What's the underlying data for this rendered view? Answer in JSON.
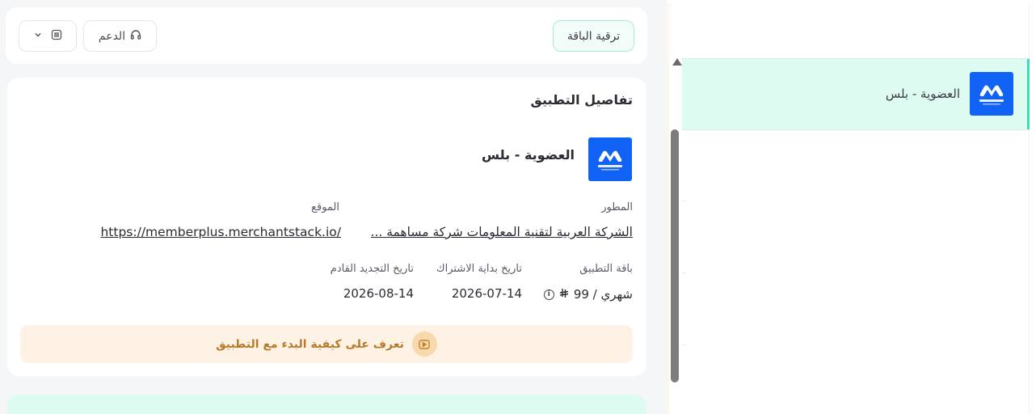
{
  "header": {
    "upgrade_label": "ترقية الباقة",
    "support_label": "الدعم"
  },
  "sidebar": {
    "items": [
      {
        "label": "العضوية - بلس",
        "active": true
      }
    ],
    "logo_text": "Member Plus"
  },
  "details": {
    "title": "تفاصيل التطبيق",
    "app_name": "العضوية - بلس",
    "logo_text": "Member Plus",
    "developer_label": "المطور",
    "developer_value": "الشركة العربية لتقنية المعلومات شركة مساهمة ...",
    "site_label": "الموقع",
    "site_value": "https://memberplus.merchantstack.io/",
    "package_label": "باقة التطبيق",
    "package_value": "شهري / 99",
    "package_currency": "⃁",
    "start_label": "تاريخ بداية الاشتراك",
    "start_value": "2026-07-14",
    "renew_label": "تاريخ التجديد القادم",
    "renew_value": "2026-08-14",
    "learn_label": "تعرف على كيفية البدء مع التطبيق"
  },
  "colors": {
    "brand_blue": "#1063f5",
    "accent_mint": "#3ddbb6",
    "banner_bg": "#fdf2e4",
    "banner_text": "#b77a2a"
  }
}
